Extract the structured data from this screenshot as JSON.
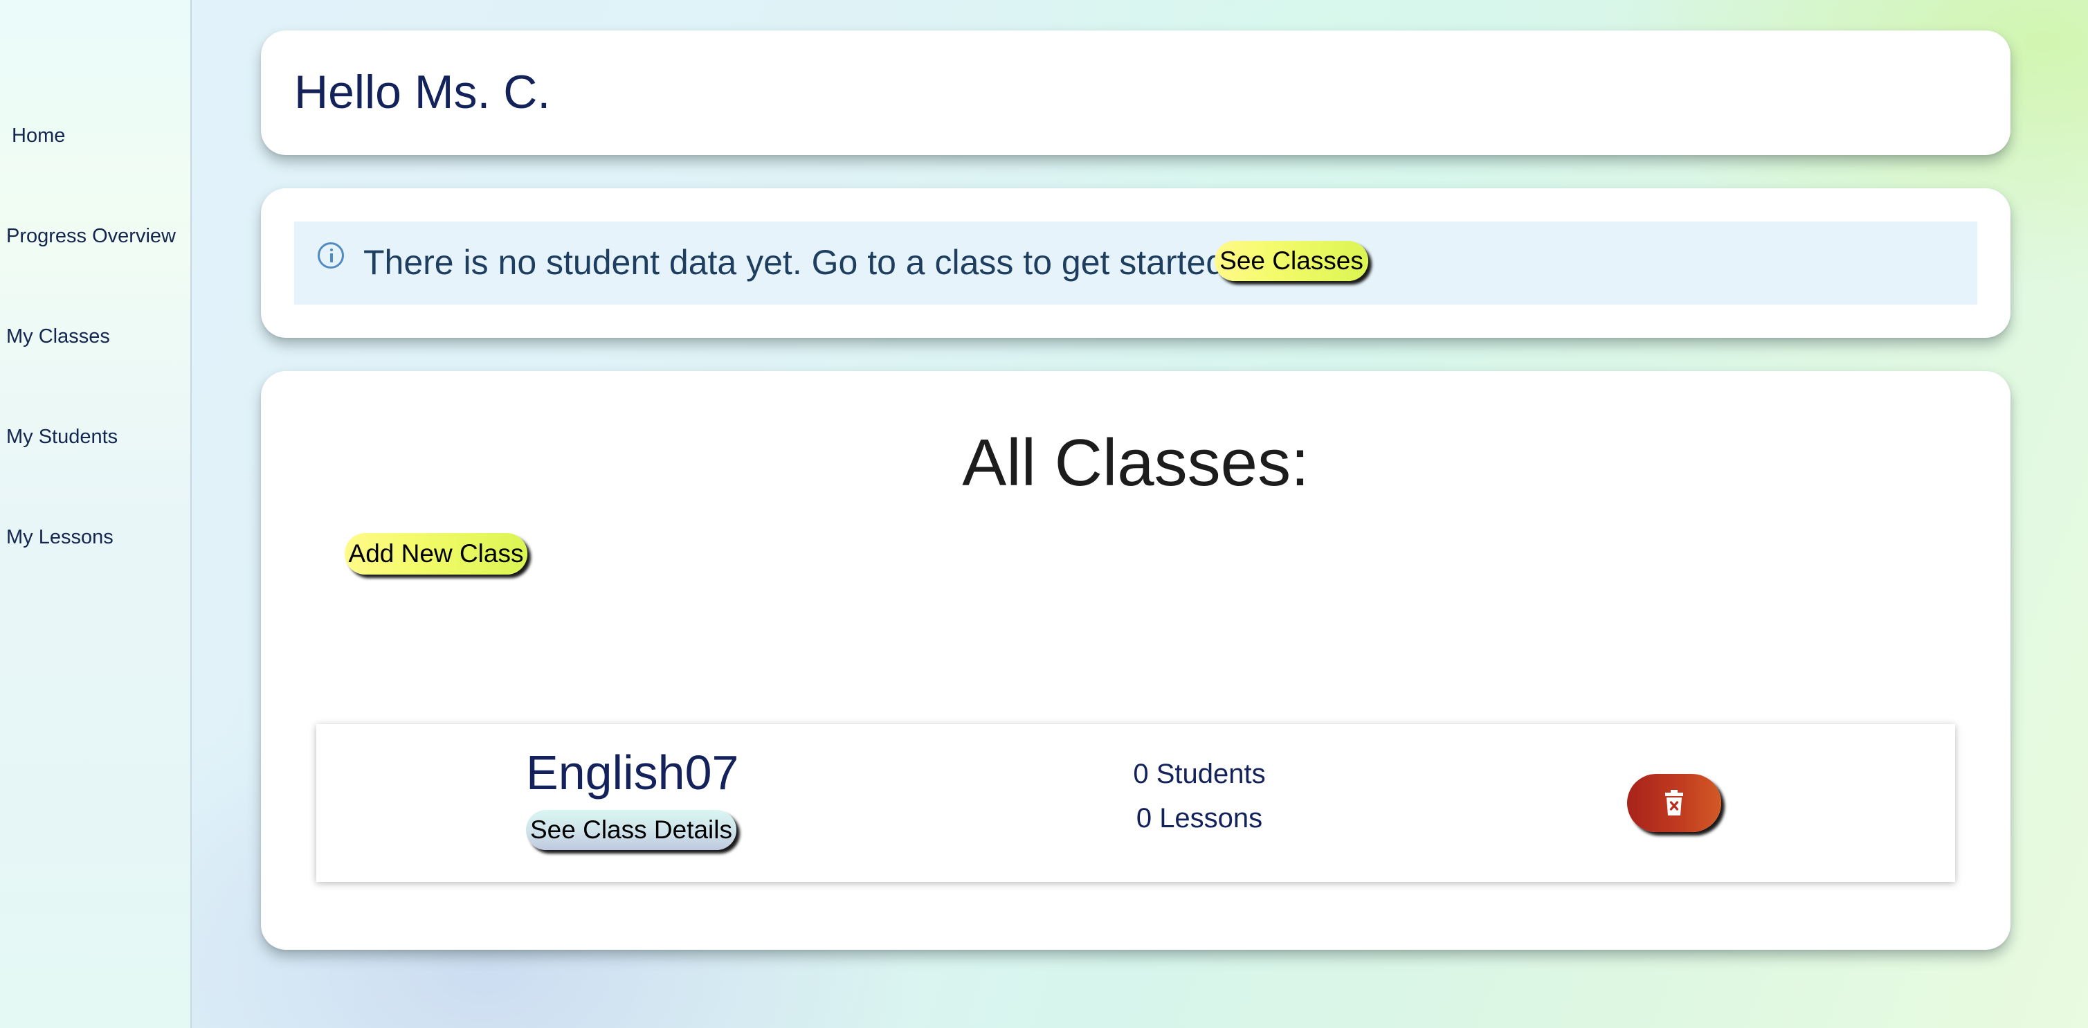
{
  "sidebar": {
    "items": [
      {
        "label": "Home"
      },
      {
        "label": "Progress Overview"
      },
      {
        "label": "My Classes"
      },
      {
        "label": "My Students"
      },
      {
        "label": "My Lessons"
      }
    ]
  },
  "header": {
    "greeting": "Hello Ms. C."
  },
  "info": {
    "icon": "info-circle-icon",
    "message": "There is no student data yet. Go to a class to get started!",
    "button_label": "See Classes"
  },
  "classes": {
    "title": "All Classes:",
    "add_button_label": "Add New Class",
    "items": [
      {
        "name": "English07",
        "details_button_label": "See Class Details",
        "students_text": "0 Students",
        "lessons_text": "0 Lessons",
        "delete_icon": "trash-icon"
      }
    ]
  },
  "colors": {
    "accent_yellow": "#f3fb6a",
    "delete_red": "#b82d1d",
    "text_navy": "#13225a",
    "info_bg": "#e6f3fa"
  }
}
